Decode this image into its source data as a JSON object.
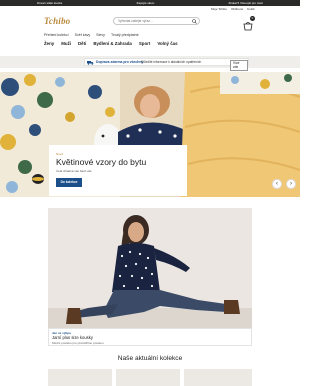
{
  "topbar": {
    "items": [
      "Dnes1 stálé stocks",
      "Zapojte slevu",
      "Získat 5 Vstoupit pro ciaci"
    ]
  },
  "header": {
    "logo": "Tchibo",
    "search_placeholder": "Vyhledat zadejte výraz...",
    "service_links": [
      "Moje Tchibo",
      "Oblíbené",
      "Košík"
    ],
    "cart_count": "0"
  },
  "subnav": [
    "Přehled kolekcí",
    "Svět kávy",
    "Slevy",
    "Trvalý předplatné"
  ],
  "mainnav": [
    "Ženy",
    "Muži",
    "Děti",
    "Bydlení & Zahrada",
    "Sport",
    "Volný čas"
  ],
  "promo": {
    "shipping": "Doprava zdarma pro všechny",
    "info": "Důležité informace k aktuálních opatřeních",
    "more": "Více zde"
  },
  "hero": {
    "eyebrow": "Nové",
    "headline": "Květinové vzory do bytu",
    "subtext": "Celá chladná vás bavit vás",
    "cta": "Do kolekce",
    "prev": "‹",
    "next": "›"
  },
  "feature": {
    "tag": "Jen ve výbpu",
    "title": "Jarní plus size kousky",
    "subtitle": "Módní postavu pro plnoštíhlou postavu"
  },
  "collections": {
    "title": "Naše aktuální kolekce"
  },
  "colors": {
    "brand_gold": "#b98a3c",
    "accent_blue": "#1c4f8a",
    "topbar": "#2a2a28"
  }
}
